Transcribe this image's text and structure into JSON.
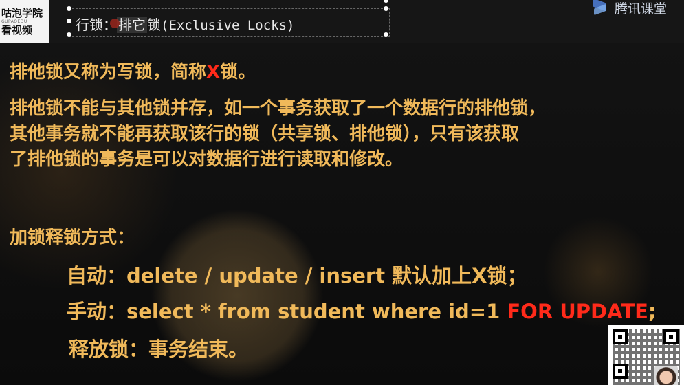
{
  "header": {
    "brand_line1": "咕泡学院",
    "brand_line2": "GUPAOEDU",
    "brand_line3": "看视频",
    "watermark_text": "腾讯课堂",
    "title_prefix": "行锁：",
    "title_highlight": "排它",
    "title_suffix": "锁",
    "title_english": "(Exclusive Locks)"
  },
  "content": {
    "line1_a": "排他锁又称为写锁，简称",
    "line1_x": "X",
    "line1_b": "锁。",
    "para": [
      "排他锁不能与其他锁并存，如一个事务获取了一个数据行的排他锁，",
      "其他事务就不能再获取该行的锁（共享锁、排他锁），只有该获取",
      "了排他锁的事务是可以对数据行进行读取和修改。"
    ],
    "heading": "加锁释锁方式：",
    "auto": "自动：delete / update / insert  默认加上X锁；",
    "manual_a": "手动：select * from student where id=1 ",
    "manual_red": "FOR UPDATE",
    "manual_b": ";",
    "release": "释放锁：事务结束。"
  },
  "colors": {
    "text": "#f0b95a",
    "highlight_red": "#ff2a1a",
    "background": "#0d0d0d"
  },
  "icons": [
    "tencent-classroom-logo-icon",
    "qr-code-icon",
    "presenter-avatar"
  ]
}
